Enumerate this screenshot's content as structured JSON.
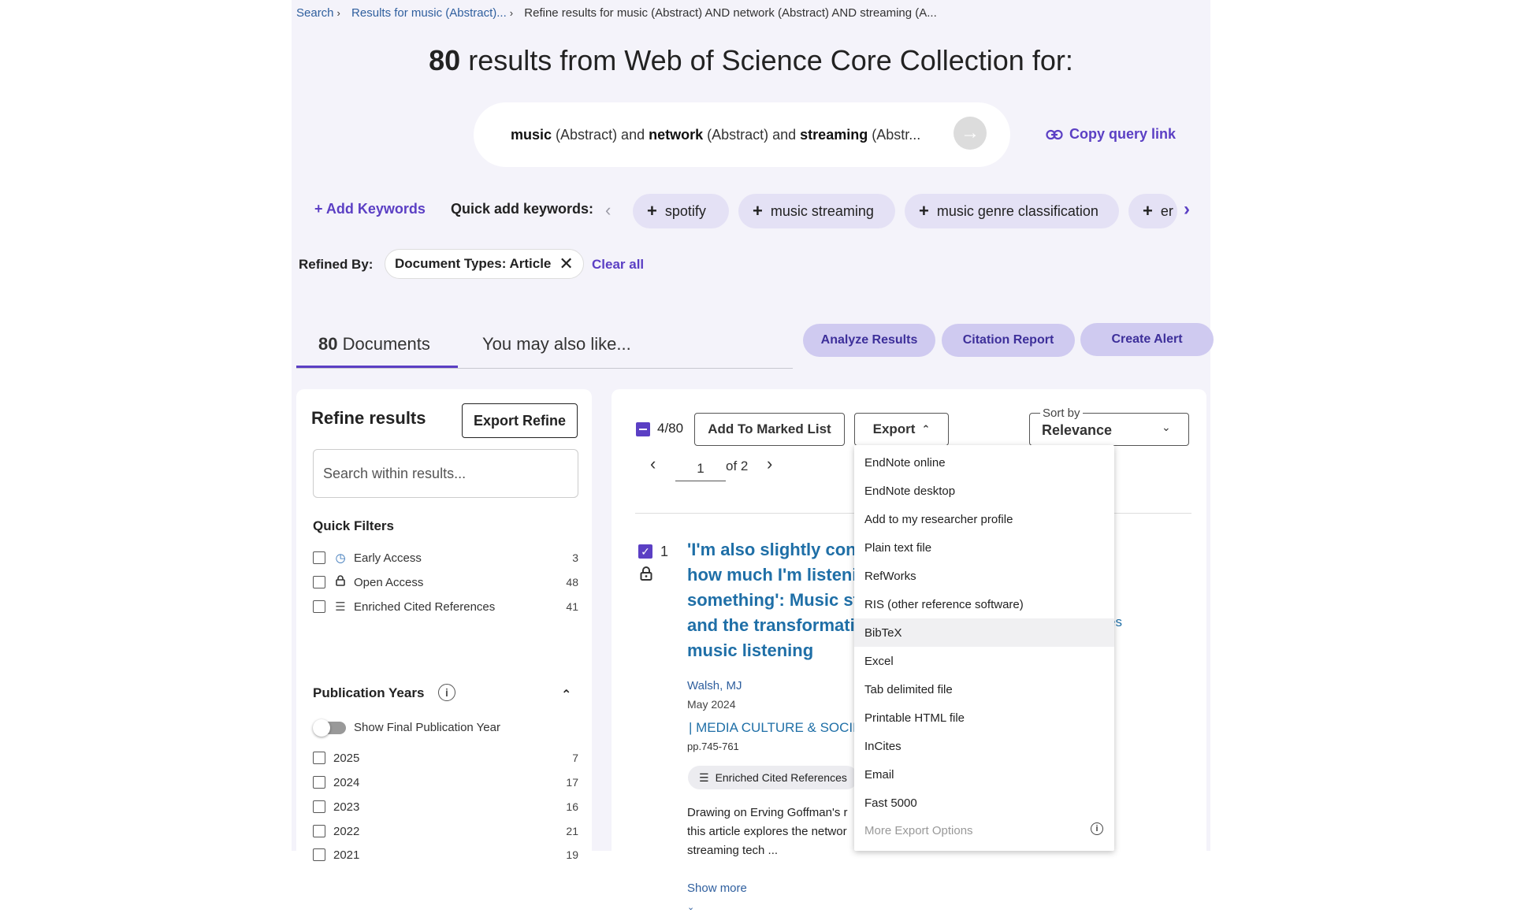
{
  "breadcrumb": {
    "items": [
      "Search",
      "Results for music (Abstract)...",
      "Refine results for music (Abstract) AND network (Abstract) AND streaming (A..."
    ]
  },
  "headline": {
    "count": "80",
    "text": "results from Web of Science Core Collection for:"
  },
  "query": {
    "t1": "music",
    "f1": "(Abstract) and ",
    "t2": "network",
    "f2": "(Abstract) and ",
    "t3": "streaming",
    "f3": "(Abstr...",
    "copy_label": "Copy query link"
  },
  "keywords": {
    "add_label": "Add Keywords",
    "quick_label": "Quick add keywords:",
    "chips": [
      "spotify",
      "music streaming",
      "music genre classification",
      "er"
    ]
  },
  "refined": {
    "label": "Refined By:",
    "filter": "Document Types: Article",
    "clear_label": "Clear all"
  },
  "tabs": {
    "count": "80",
    "documents": "Documents",
    "also_like": "You may also like..."
  },
  "actions": {
    "analyze": "Analyze Results",
    "citation": "Citation Report",
    "alert": "Create Alert"
  },
  "refine": {
    "title": "Refine results",
    "export_label": "Export Refine",
    "search_placeholder": "Search within results...",
    "quick_filters_title": "Quick Filters",
    "quick_filters": [
      {
        "label": "Early Access",
        "count": "3"
      },
      {
        "label": "Open Access",
        "count": "48"
      },
      {
        "label": "Enriched Cited References",
        "count": "41"
      }
    ],
    "pub_years_title": "Publication Years",
    "toggle_label": "Show Final Publication Year",
    "years": [
      {
        "label": "2025",
        "count": "7"
      },
      {
        "label": "2024",
        "count": "17"
      },
      {
        "label": "2023",
        "count": "16"
      },
      {
        "label": "2022",
        "count": "21"
      },
      {
        "label": "2021",
        "count": "19"
      }
    ]
  },
  "results": {
    "selected": "4/80",
    "add_marked": "Add To Marked List",
    "export_label": "Export",
    "sort_label": "Sort by",
    "sort_value": "Relevance",
    "page": "1",
    "of_pages": "of 2"
  },
  "record": {
    "num": "1",
    "title_lines": [
      "'I'm also slightly cons",
      "how much I'm listeni",
      "something': Music st",
      "and the transformati",
      "music listening"
    ],
    "author": "Walsh, MJ",
    "date": "May 2024",
    "journal": "| MEDIA CULTURE & SOCIET",
    "pages": "pp.745-761",
    "badge": "Enriched Cited References",
    "abstract_lines": [
      "Drawing on Erving Goffman's r",
      "this article explores the networ",
      "streaming tech ..."
    ],
    "show_more": "Show more",
    "frag1": "s",
    "frag2": "es"
  },
  "export_menu": {
    "items": [
      "EndNote online",
      "EndNote desktop",
      "Add to my researcher profile",
      "Plain text file",
      "RefWorks",
      "RIS (other reference software)",
      "BibTeX",
      "Excel",
      "Tab delimited file",
      "Printable HTML file",
      "InCites",
      "Email",
      "Fast 5000"
    ],
    "more": "More Export Options",
    "highlighted": "BibTeX"
  }
}
